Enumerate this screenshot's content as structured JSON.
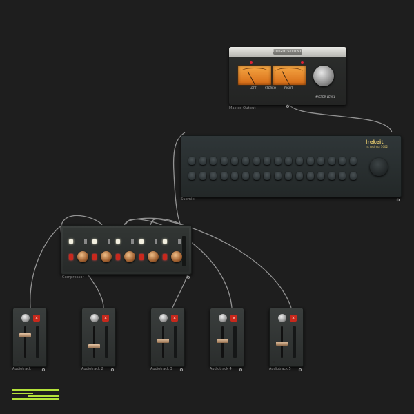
{
  "master": {
    "brand": "LOGICSOUND",
    "label": "Master Output",
    "vu_left_caption": "LEFT",
    "vu_mid_caption": "STEREO",
    "vu_right_caption": "RIGHT",
    "knob_caption": "MASTER LEVEL"
  },
  "submix": {
    "label": "Submix",
    "logo": "lrekeit",
    "logo_sub": "ns resinoa 1602"
  },
  "compressor": {
    "label": "Compressor"
  },
  "tracks": [
    {
      "label": "Audiotrack",
      "fader_level": 0.75
    },
    {
      "label": "Audiotrack 2",
      "fader_level": 0.35
    },
    {
      "label": "Audiotrack 3",
      "fader_level": 0.55
    },
    {
      "label": "Audiotrack 4",
      "fader_level": 0.55
    },
    {
      "label": "Audiotrack 5",
      "fader_level": 0.45
    }
  ],
  "colors": {
    "background": "#1e1e1e",
    "cable": "#a8a8a8",
    "accent_green": "#b4e33a",
    "mute_red": "#c7281c",
    "vu_orange": "#f6a845"
  },
  "icons": {
    "module_menu": "gear-icon",
    "app_logo": "app-logo-icon"
  }
}
